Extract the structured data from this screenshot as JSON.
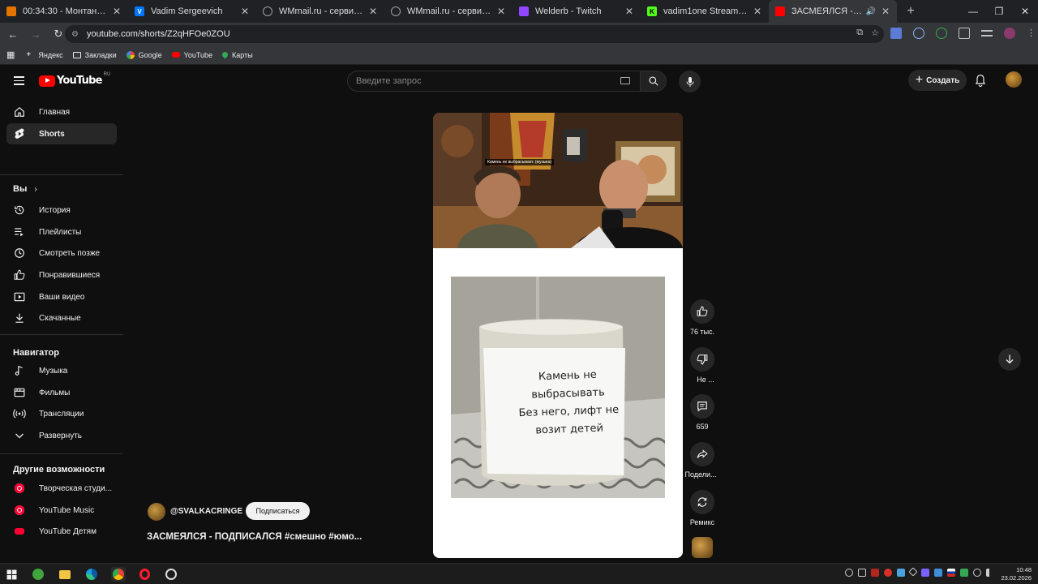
{
  "browser": {
    "tabs": [
      {
        "title": "00:34:30 - Монтана - The West",
        "favicon": "orange-box-icon",
        "color": "#e37400"
      },
      {
        "title": "Vadim Sergeevich",
        "favicon": "vk-icon",
        "color": "#0077ff"
      },
      {
        "title": "WMmail.ru - сервис почтовых",
        "favicon": "globe-icon",
        "color": "#9aa0a6"
      },
      {
        "title": "WMmail.ru - сервис почтовых",
        "favicon": "globe-icon",
        "color": "#9aa0a6"
      },
      {
        "title": "Welderb - Twitch",
        "favicon": "twitch-icon",
        "color": "#9146ff"
      },
      {
        "title": "vadim1one Stream - Watch Live",
        "favicon": "kick-icon",
        "color": "#53fc18"
      },
      {
        "title": "ЗАСМЕЯЛСЯ - ПОДПИСАЛСЯ",
        "favicon": "youtube-icon",
        "color": "#ff0000",
        "active": true
      }
    ],
    "url": "youtube.com/shorts/Z2qHFOe0ZOU",
    "bookmarks": [
      {
        "label": "Яндекс",
        "icon": "plus-icon"
      },
      {
        "label": "Закладки",
        "icon": "folder-icon"
      },
      {
        "label": "Google",
        "icon": "google-icon"
      },
      {
        "label": "YouTube",
        "icon": "youtube-icon"
      },
      {
        "label": "Карты",
        "icon": "maps-pin-icon"
      }
    ]
  },
  "header": {
    "logo_text": "YouTube",
    "country": "RU",
    "search_placeholder": "Введите запрос",
    "create_label": "Создать"
  },
  "sidebar": {
    "main": [
      {
        "label": "Главная",
        "icon": "home-icon"
      },
      {
        "label": "Shorts",
        "icon": "shorts-icon",
        "active": true
      }
    ],
    "you_heading": "Вы",
    "you": [
      {
        "label": "История",
        "icon": "history-icon"
      },
      {
        "label": "Плейлисты",
        "icon": "playlists-icon"
      },
      {
        "label": "Смотреть позже",
        "icon": "clock-icon"
      },
      {
        "label": "Понравившиеся",
        "icon": "thumb-up-icon"
      },
      {
        "label": "Ваши видео",
        "icon": "video-icon"
      },
      {
        "label": "Скачанные",
        "icon": "download-icon"
      }
    ],
    "nav_heading": "Навигатор",
    "nav": [
      {
        "label": "Музыка",
        "icon": "music-note-icon"
      },
      {
        "label": "Фильмы",
        "icon": "film-icon"
      },
      {
        "label": "Трансляции",
        "icon": "live-icon"
      },
      {
        "label": "Развернуть",
        "icon": "chevron-down-icon"
      }
    ],
    "more_heading": "Другие возможности",
    "more": [
      {
        "label": "Творческая студи...",
        "icon": "studio-icon"
      },
      {
        "label": "YouTube Music",
        "icon": "yt-music-icon"
      },
      {
        "label": "YouTube Детям",
        "icon": "yt-kids-icon"
      }
    ]
  },
  "short": {
    "overlay_caption": "Камень не выбрасывает. (музыка)",
    "sign_lines": [
      "Камень не",
      "выбрасывать",
      "Без него, лифт не",
      "возит детей"
    ],
    "channel": "@SVALKACRINGE",
    "subscribe_label": "Подписаться",
    "title": "ЗАСМЕЯЛСЯ - ПОДПИСАЛСЯ #смешно #юмо..."
  },
  "actions": {
    "likes": "76 тыс.",
    "dislike": "Не ...",
    "comments": "659",
    "share": "Подели...",
    "remix": "Ремикс"
  },
  "taskbar": {
    "time": "10:48",
    "date": "23.02.2026"
  }
}
